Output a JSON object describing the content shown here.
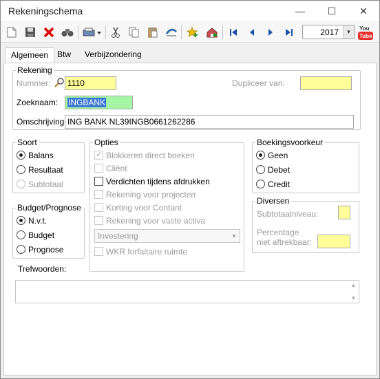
{
  "window": {
    "title": "Rekeningschema",
    "minimize_glyph": "—",
    "maximize_glyph": "☐",
    "close_glyph": "✕"
  },
  "toolbar": {
    "year": "2017",
    "youtube_label": "You\nTube"
  },
  "tabs": [
    "Algemeen",
    "Btw",
    "Verbijzondering"
  ],
  "rekening": {
    "legend": "Rekening",
    "nummer_label": "Nummer:",
    "nummer_value": "1110",
    "dupliceer_label": "Dupliceer van:",
    "dupliceer_value": "",
    "zoeknaam_label": "Zoeknaam:",
    "zoeknaam_value": "INGBANK",
    "omschrijving_label": "Omschrijving:",
    "omschrijving_value": "ING BANK NL39INGB0661262286"
  },
  "soort": {
    "legend": "Soort",
    "options": [
      "Balans",
      "Resultaat",
      "Subtotaal"
    ],
    "selected": "Balans"
  },
  "opties": {
    "legend": "Opties",
    "items": [
      "Blokkeren direct boeken",
      "Cliënt",
      "Verdichten tijdens afdrukken",
      "Rekening voor projecten",
      "Korting voor Contant",
      "Rekening voor vaste activa"
    ],
    "investering_select": "Investering",
    "wkr": "WKR forfaitaire ruimte"
  },
  "budget": {
    "legend": "Budget/Prognose",
    "options": [
      "N.v.t.",
      "Budget",
      "Prognose"
    ],
    "selected": "N.v.t."
  },
  "boekingsvoorkeur": {
    "legend": "Boekingsvoorkeur",
    "options": [
      "Geen",
      "Debet",
      "Credit"
    ],
    "selected": "Geen"
  },
  "diversen": {
    "legend": "Diversen",
    "subtotaal_label": "Subtotaalniveau:",
    "percentage_label_1": "Percentage",
    "percentage_label_2": "niet aftrekbaar:"
  },
  "trefwoorden": {
    "label": "Trefwoorden:"
  }
}
